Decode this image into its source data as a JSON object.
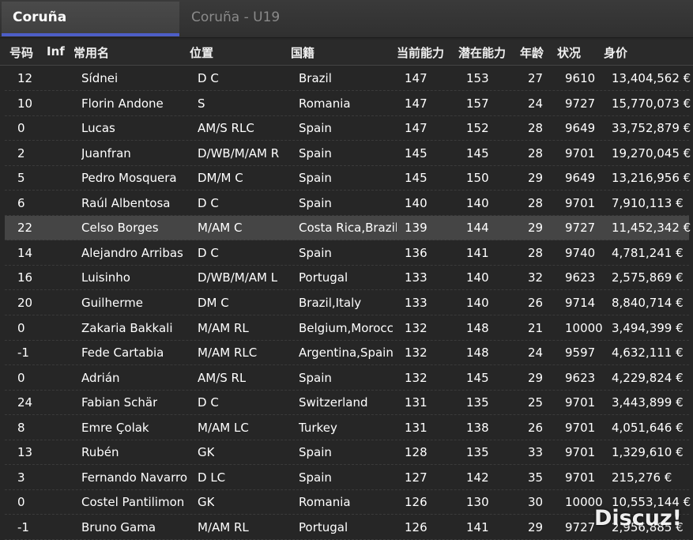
{
  "tabs": [
    {
      "label": "Coruña",
      "active": true
    },
    {
      "label": "Coruña - U19",
      "active": false
    }
  ],
  "columns": [
    "号码",
    "Inf",
    "常用名",
    "位置",
    "国籍",
    "当前能力",
    "潜在能力",
    "年龄",
    "状况",
    "身价"
  ],
  "rows": [
    {
      "num": "12",
      "inf": "",
      "name": "Sídnei",
      "pos": "D C",
      "nat": "Brazil",
      "ca": "147",
      "pa": "153",
      "age": "27",
      "cond": "9610",
      "value": "13,404,562 €"
    },
    {
      "num": "10",
      "inf": "",
      "name": "Florin Andone",
      "pos": "S",
      "nat": "Romania",
      "ca": "147",
      "pa": "157",
      "age": "24",
      "cond": "9727",
      "value": "15,770,073 €"
    },
    {
      "num": "0",
      "inf": "",
      "name": "Lucas",
      "pos": "AM/S RLC",
      "nat": "Spain",
      "ca": "147",
      "pa": "152",
      "age": "28",
      "cond": "9649",
      "value": "33,752,879 €"
    },
    {
      "num": "2",
      "inf": "",
      "name": "Juanfran",
      "pos": "D/WB/M/AM R",
      "nat": "Spain",
      "ca": "145",
      "pa": "145",
      "age": "28",
      "cond": "9701",
      "value": "19,270,045 €"
    },
    {
      "num": "5",
      "inf": "",
      "name": "Pedro Mosquera",
      "pos": "DM/M C",
      "nat": "Spain",
      "ca": "145",
      "pa": "150",
      "age": "29",
      "cond": "9649",
      "value": "13,216,956 €"
    },
    {
      "num": "6",
      "inf": "",
      "name": "Raúl Albentosa",
      "pos": "D C",
      "nat": "Spain",
      "ca": "140",
      "pa": "140",
      "age": "28",
      "cond": "9701",
      "value": "7,910,113 €"
    },
    {
      "num": "22",
      "inf": "",
      "name": "Celso Borges",
      "pos": "M/AM C",
      "nat": "Costa Rica,Brazil",
      "ca": "139",
      "pa": "144",
      "age": "29",
      "cond": "9727",
      "value": "11,452,342 €",
      "selected": true
    },
    {
      "num": "14",
      "inf": "",
      "name": "Alejandro Arribas",
      "pos": "D C",
      "nat": "Spain",
      "ca": "136",
      "pa": "141",
      "age": "28",
      "cond": "9740",
      "value": "4,781,241 €"
    },
    {
      "num": "16",
      "inf": "",
      "name": "Luisinho",
      "pos": "D/WB/M/AM L",
      "nat": "Portugal",
      "ca": "133",
      "pa": "140",
      "age": "32",
      "cond": "9623",
      "value": "2,575,869 €"
    },
    {
      "num": "20",
      "inf": "",
      "name": "Guilherme",
      "pos": "DM C",
      "nat": "Brazil,Italy",
      "ca": "133",
      "pa": "140",
      "age": "26",
      "cond": "9714",
      "value": "8,840,714 €"
    },
    {
      "num": "0",
      "inf": "",
      "name": "Zakaria Bakkali",
      "pos": "M/AM RL",
      "nat": "Belgium,Morocc",
      "ca": "132",
      "pa": "148",
      "age": "21",
      "cond": "10000",
      "value": "3,494,399 €"
    },
    {
      "num": "-1",
      "inf": "",
      "name": "Fede Cartabia",
      "pos": "M/AM RLC",
      "nat": "Argentina,Spain",
      "ca": "132",
      "pa": "148",
      "age": "24",
      "cond": "9597",
      "value": "4,632,111 €"
    },
    {
      "num": "0",
      "inf": "",
      "name": "Adrián",
      "pos": "AM/S RL",
      "nat": "Spain",
      "ca": "132",
      "pa": "145",
      "age": "29",
      "cond": "9623",
      "value": "4,229,824 €"
    },
    {
      "num": "24",
      "inf": "",
      "name": "Fabian Schär",
      "pos": "D C",
      "nat": "Switzerland",
      "ca": "131",
      "pa": "135",
      "age": "25",
      "cond": "9701",
      "value": "3,443,899 €"
    },
    {
      "num": "8",
      "inf": "",
      "name": "Emre Çolak",
      "pos": "M/AM LC",
      "nat": "Turkey",
      "ca": "131",
      "pa": "138",
      "age": "26",
      "cond": "9701",
      "value": "4,051,646 €"
    },
    {
      "num": "13",
      "inf": "",
      "name": "Rubén",
      "pos": "GK",
      "nat": "Spain",
      "ca": "128",
      "pa": "135",
      "age": "33",
      "cond": "9701",
      "value": "1,329,610 €"
    },
    {
      "num": "3",
      "inf": "",
      "name": "Fernando Navarro",
      "pos": "D LC",
      "nat": "Spain",
      "ca": "127",
      "pa": "142",
      "age": "35",
      "cond": "9701",
      "value": "215,276 €"
    },
    {
      "num": "0",
      "inf": "",
      "name": "Costel Pantilimon",
      "pos": "GK",
      "nat": "Romania",
      "ca": "126",
      "pa": "130",
      "age": "30",
      "cond": "10000",
      "value": "10,553,144 €"
    },
    {
      "num": "-1",
      "inf": "",
      "name": "Bruno Gama",
      "pos": "M/AM RL",
      "nat": "Portugal",
      "ca": "126",
      "pa": "141",
      "age": "29",
      "cond": "9727",
      "value": "2,956,885 €"
    }
  ],
  "watermark": "Discuz!"
}
